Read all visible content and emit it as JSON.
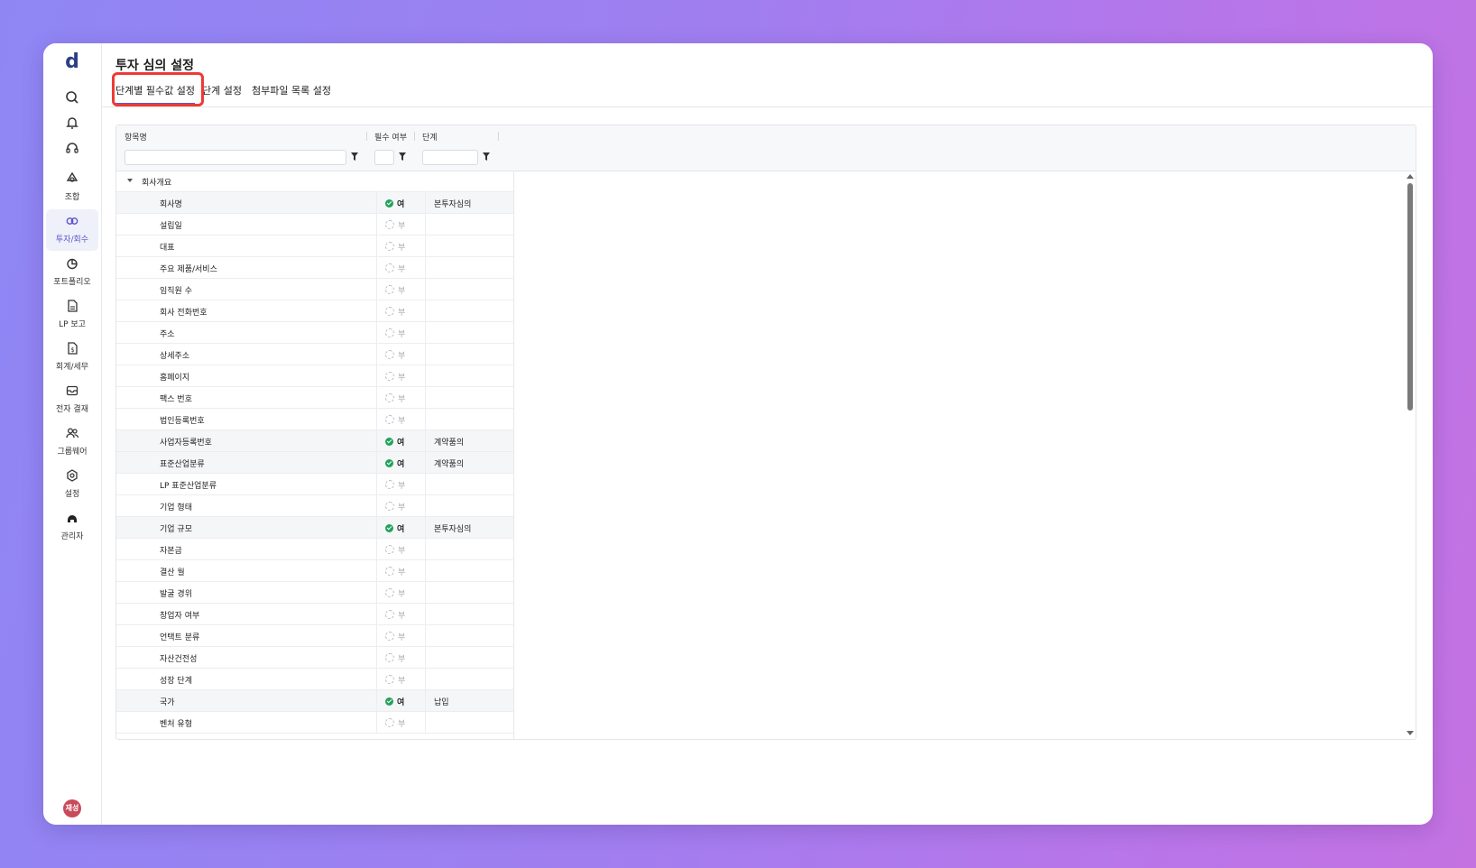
{
  "app": {
    "logo": "d",
    "avatar_label": "재성"
  },
  "sidebar": {
    "items": [
      {
        "label": "조합",
        "icon": "cycle-icon"
      },
      {
        "label": "투자/회수",
        "icon": "link-icon"
      },
      {
        "label": "포트폴리오",
        "icon": "pie-chart-icon"
      },
      {
        "label": "LP 보고",
        "icon": "document-icon"
      },
      {
        "label": "회계/세무",
        "icon": "invoice-icon"
      },
      {
        "label": "전자 결재",
        "icon": "mail-icon"
      },
      {
        "label": "그룹웨어",
        "icon": "users-icon"
      },
      {
        "label": "설정",
        "icon": "gear-icon"
      },
      {
        "label": "관리자",
        "icon": "admin-icon"
      }
    ],
    "active_index": 1
  },
  "page": {
    "title": "투자 심의 설정"
  },
  "tabs": [
    {
      "label": "단계별 필수값 설정",
      "active": true
    },
    {
      "label": "단계 설정",
      "active": false
    },
    {
      "label": "첨부파일 목록 설정",
      "active": false
    }
  ],
  "grid": {
    "columns": {
      "name": "항목명",
      "required": "필수 여부",
      "stage": "단계"
    },
    "group_label": "회사개요",
    "yes_label": "여",
    "no_label": "부",
    "rows": [
      {
        "name": "회사명",
        "required": true,
        "stage": "본투자심의"
      },
      {
        "name": "설립일",
        "required": false,
        "stage": ""
      },
      {
        "name": "대표",
        "required": false,
        "stage": ""
      },
      {
        "name": "주요 제품/서비스",
        "required": false,
        "stage": ""
      },
      {
        "name": "임직원 수",
        "required": false,
        "stage": ""
      },
      {
        "name": "회사 전화번호",
        "required": false,
        "stage": ""
      },
      {
        "name": "주소",
        "required": false,
        "stage": ""
      },
      {
        "name": "상세주소",
        "required": false,
        "stage": ""
      },
      {
        "name": "홈페이지",
        "required": false,
        "stage": ""
      },
      {
        "name": "팩스 번호",
        "required": false,
        "stage": ""
      },
      {
        "name": "법인등록번호",
        "required": false,
        "stage": ""
      },
      {
        "name": "사업자등록번호",
        "required": true,
        "stage": "계약품의"
      },
      {
        "name": "표준산업분류",
        "required": true,
        "stage": "계약품의"
      },
      {
        "name": "LP 표준산업분류",
        "required": false,
        "stage": ""
      },
      {
        "name": "기업 형태",
        "required": false,
        "stage": ""
      },
      {
        "name": "기업 규모",
        "required": true,
        "stage": "본투자심의"
      },
      {
        "name": "자본금",
        "required": false,
        "stage": ""
      },
      {
        "name": "결산 월",
        "required": false,
        "stage": ""
      },
      {
        "name": "발굴 경위",
        "required": false,
        "stage": ""
      },
      {
        "name": "창업자 여부",
        "required": false,
        "stage": ""
      },
      {
        "name": "언택트 분류",
        "required": false,
        "stage": ""
      },
      {
        "name": "자산건전성",
        "required": false,
        "stage": ""
      },
      {
        "name": "성장 단계",
        "required": false,
        "stage": ""
      },
      {
        "name": "국가",
        "required": true,
        "stage": "납입"
      },
      {
        "name": "벤처 유형",
        "required": false,
        "stage": ""
      }
    ]
  },
  "colors": {
    "accent": "#5b5bd0",
    "highlight": "#ee3a36",
    "yes": "#22a35a"
  }
}
